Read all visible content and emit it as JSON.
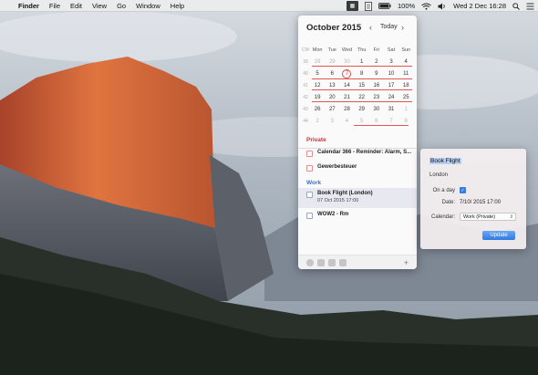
{
  "menubar": {
    "apple_icon": "apple-logo-icon",
    "app_name": "Finder",
    "menus": [
      "File",
      "Edit",
      "View",
      "Go",
      "Window",
      "Help"
    ],
    "status": {
      "battery_percent": "100%",
      "datetime": "Wed 2 Dec  16:28"
    }
  },
  "calendar": {
    "month_title": "October 2015",
    "today_label": "Today",
    "weekdays": [
      "Mon",
      "Tue",
      "Wed",
      "Thu",
      "Fri",
      "Sat",
      "Sun"
    ],
    "weeks": [
      {
        "wk": "39",
        "days": [
          "28",
          "29",
          "30",
          "1",
          "2",
          "3",
          "4"
        ]
      },
      {
        "wk": "40",
        "days": [
          "5",
          "6",
          "7",
          "8",
          "9",
          "10",
          "11"
        ]
      },
      {
        "wk": "41",
        "days": [
          "12",
          "13",
          "14",
          "15",
          "16",
          "17",
          "18"
        ]
      },
      {
        "wk": "42",
        "days": [
          "19",
          "20",
          "21",
          "22",
          "23",
          "24",
          "25"
        ]
      },
      {
        "wk": "43",
        "days": [
          "26",
          "27",
          "28",
          "29",
          "30",
          "31",
          "1"
        ]
      },
      {
        "wk": "44",
        "days": [
          "2",
          "3",
          "4",
          "5",
          "6",
          "7",
          "8"
        ]
      }
    ],
    "today": "7",
    "sections": [
      {
        "title": "Private",
        "color": "#cc3333",
        "events": [
          {
            "title": "Calendar 366 - Reminder: Alarm, S..."
          },
          {
            "title": "Gewerbesteuer"
          }
        ]
      },
      {
        "title": "Work",
        "color": "#3b6fd1",
        "events": [
          {
            "title": "Book Flight (London)",
            "time": "07 Oct 2015 17:00"
          },
          {
            "title": "WOW2 - Rm"
          }
        ]
      }
    ]
  },
  "editor": {
    "title": "Book Flight",
    "location": "London",
    "on_a_day_label": "On a day",
    "date_label": "Date:",
    "date_value": "7/10/ 2015  17:00",
    "calendar_label": "Calendar:",
    "calendar_value": "Work (Private)",
    "update_label": "Update"
  },
  "colors": {
    "accent_red": "#e25555",
    "accent_blue": "#2f7ae4"
  }
}
